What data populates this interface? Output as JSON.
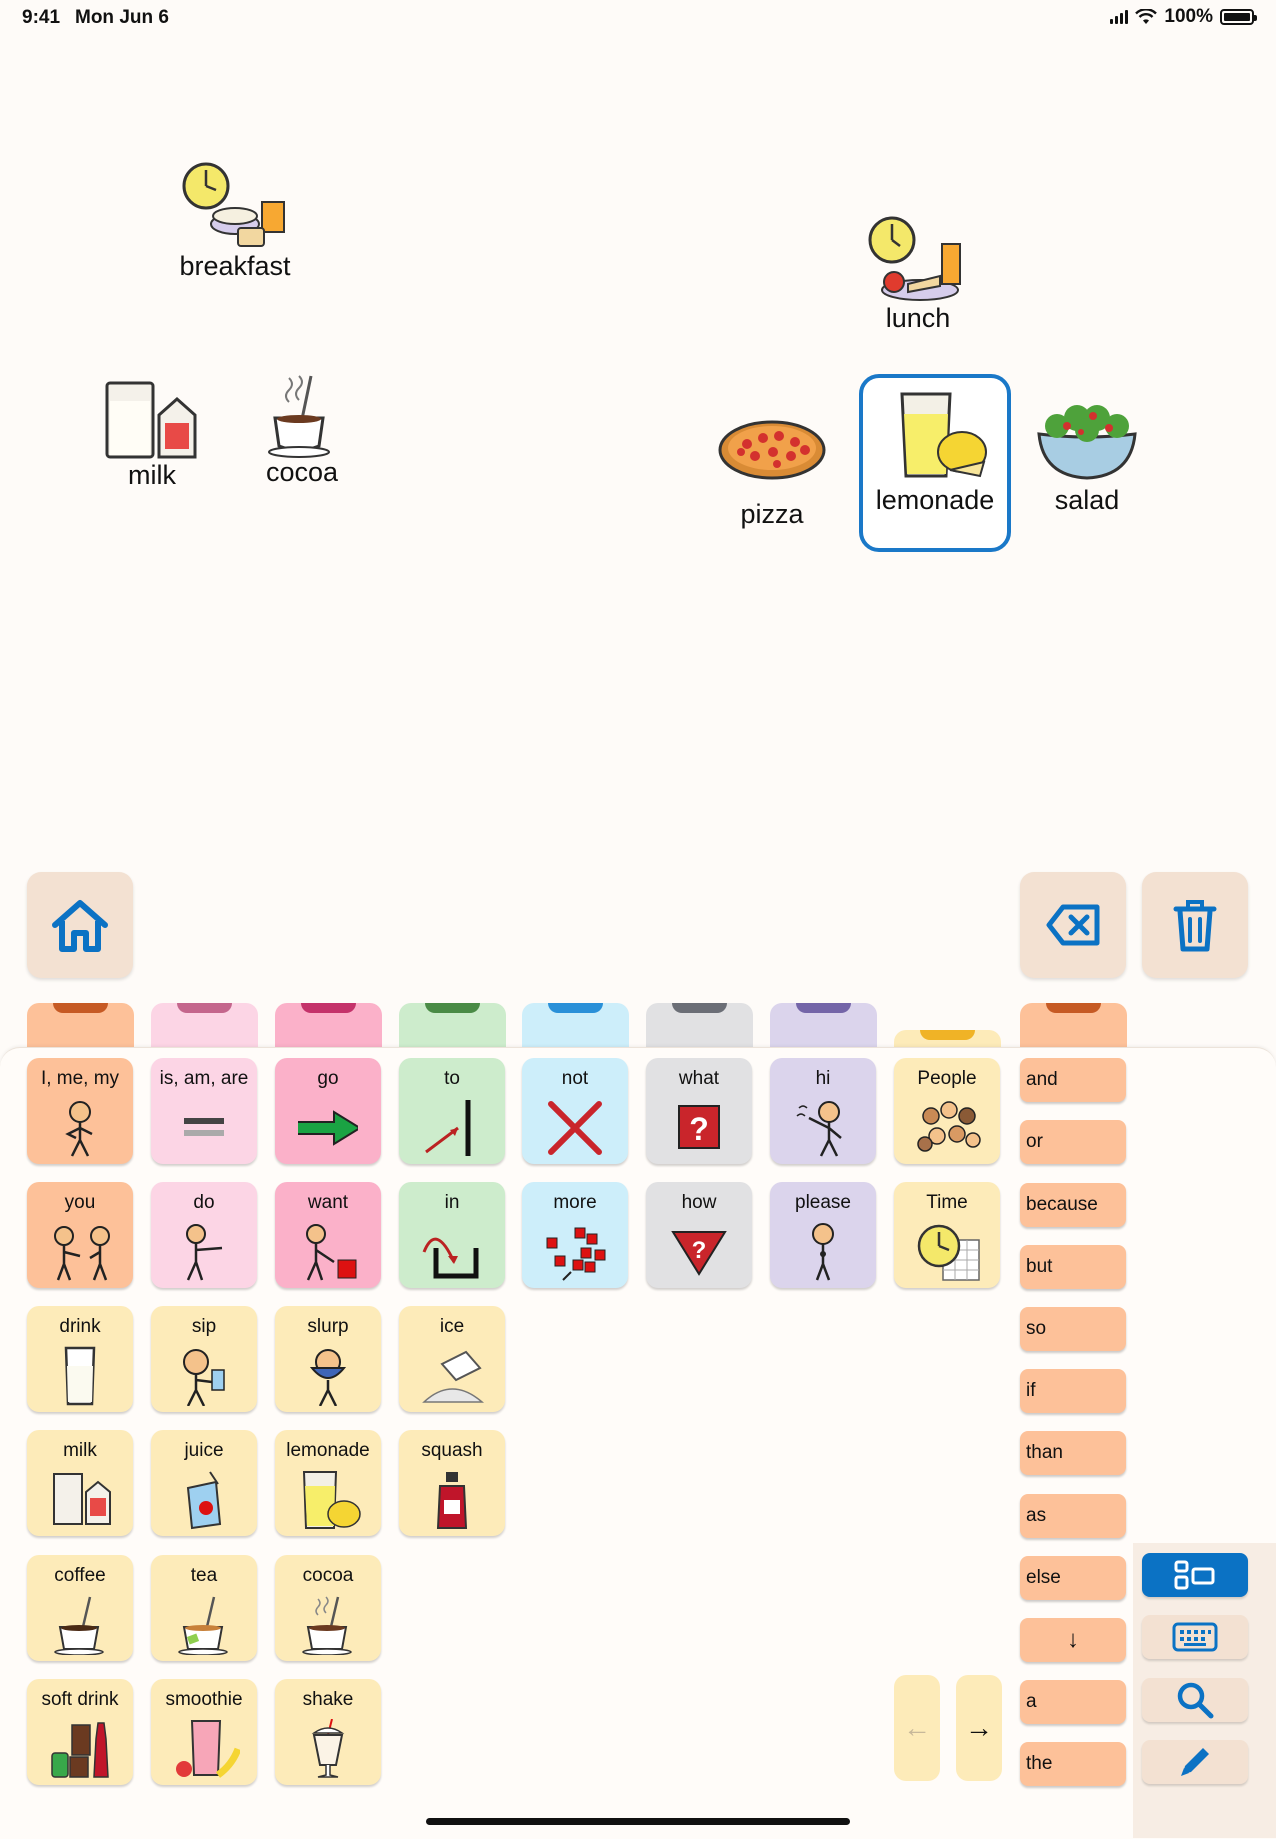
{
  "status_bar": {
    "time": "9:41",
    "date": "Mon Jun 6",
    "battery": "100%"
  },
  "canvas": {
    "items": [
      {
        "label": "breakfast",
        "icon": "breakfast-icon"
      },
      {
        "label": "milk",
        "icon": "milk-icon"
      },
      {
        "label": "cocoa",
        "icon": "cocoa-icon"
      },
      {
        "label": "lunch",
        "icon": "lunch-icon"
      },
      {
        "label": "pizza",
        "icon": "pizza-icon"
      },
      {
        "label": "lemonade",
        "icon": "lemonade-icon",
        "selected": true
      },
      {
        "label": "salad",
        "icon": "salad-icon"
      }
    ]
  },
  "toolbar": {
    "home": "home-icon",
    "backspace": "backspace-icon",
    "clear": "trash-icon"
  },
  "colors": {
    "pronoun": "#fdc199",
    "verb_pink": "#fcd5e5",
    "verb_hot": "#fbb1c9",
    "preposition": "#cdeccc",
    "negation": "#cdeefa",
    "question": "#e1e1e3",
    "social": "#dbd4ec",
    "folder": "#fdebb9",
    "accent": "#0b72c4"
  },
  "grid": {
    "row1": [
      {
        "label": "I, me, my",
        "icon": "me-icon"
      },
      {
        "label": "is, am, are",
        "icon": "equals-icon"
      },
      {
        "label": "go",
        "icon": "arrow-right-icon"
      },
      {
        "label": "to",
        "icon": "to-icon"
      },
      {
        "label": "not",
        "icon": "x-icon"
      },
      {
        "label": "what",
        "icon": "question-box-icon"
      },
      {
        "label": "hi",
        "icon": "wave-icon"
      },
      {
        "label": "People",
        "icon": "people-icon"
      }
    ],
    "row2": [
      {
        "label": "you",
        "icon": "you-icon"
      },
      {
        "label": "do",
        "icon": "do-icon"
      },
      {
        "label": "want",
        "icon": "want-icon"
      },
      {
        "label": "in",
        "icon": "in-icon"
      },
      {
        "label": "more",
        "icon": "more-icon"
      },
      {
        "label": "how",
        "icon": "how-icon"
      },
      {
        "label": "please",
        "icon": "please-icon"
      },
      {
        "label": "Time",
        "icon": "clock-icon"
      }
    ],
    "row3": [
      {
        "label": "drink",
        "icon": "glass-icon"
      },
      {
        "label": "sip",
        "icon": "sip-icon"
      },
      {
        "label": "slurp",
        "icon": "slurp-icon"
      },
      {
        "label": "ice",
        "icon": "ice-icon"
      }
    ],
    "row4": [
      {
        "label": "milk",
        "icon": "milk-icon"
      },
      {
        "label": "juice",
        "icon": "juice-box-icon"
      },
      {
        "label": "lemonade",
        "icon": "lemonade-icon"
      },
      {
        "label": "squash",
        "icon": "squash-bottle-icon"
      }
    ],
    "row5": [
      {
        "label": "coffee",
        "icon": "coffee-icon"
      },
      {
        "label": "tea",
        "icon": "tea-icon"
      },
      {
        "label": "cocoa",
        "icon": "cocoa-icon"
      }
    ],
    "row6": [
      {
        "label": "soft drink",
        "icon": "soft-drink-icon"
      },
      {
        "label": "smoothie",
        "icon": "smoothie-icon"
      },
      {
        "label": "shake",
        "icon": "shake-icon"
      }
    ]
  },
  "words": [
    "and",
    "or",
    "because",
    "but",
    "so",
    "if",
    "than",
    "as",
    "else",
    "↓",
    "a",
    "the"
  ],
  "nav": {
    "prev": "←",
    "next": "→"
  },
  "sidebar": [
    "grid-view-icon",
    "keyboard-icon",
    "search-icon",
    "pencil-icon"
  ]
}
